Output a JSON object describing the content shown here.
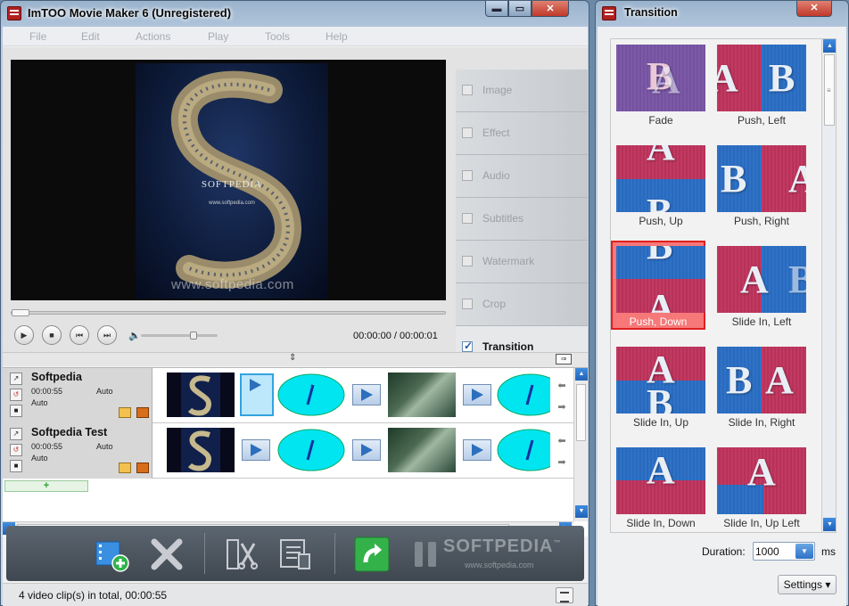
{
  "main_window": {
    "title": "ImTOO Movie Maker 6 (Unregistered)",
    "controls": {
      "minimize": "▬",
      "maximize": "▭",
      "close": "✕"
    }
  },
  "menu": [
    "File",
    "Edit",
    "Actions",
    "Play",
    "Tools",
    "Help"
  ],
  "preview": {
    "poster_brand": "SOFTPEDIA",
    "poster_url": "www.softpedia.com",
    "watermark": "www.softpedia.com",
    "seek_progress": 0.0,
    "volume_level": 0.7,
    "timecode": "00:00:00 / 00:00:01"
  },
  "side_tabs": [
    {
      "label": "Image",
      "checked": false
    },
    {
      "label": "Effect",
      "checked": false
    },
    {
      "label": "Audio",
      "checked": false
    },
    {
      "label": "Subtitles",
      "checked": false
    },
    {
      "label": "Watermark",
      "checked": false
    },
    {
      "label": "Crop",
      "checked": false
    },
    {
      "label": "Transition",
      "checked": true
    }
  ],
  "tracks": [
    {
      "name": "Softpedia",
      "duration": "00:00:55",
      "mode": "Auto",
      "audio_mode": "Auto"
    },
    {
      "name": "Softpedia Test",
      "duration": "00:00:55",
      "mode": "Auto",
      "audio_mode": "Auto"
    }
  ],
  "add_track_label": "+",
  "toolbar": {
    "watermark": "SOFTPEDIA",
    "watermark_tm": "™",
    "watermark_url": "www.softpedia.com"
  },
  "status": {
    "text": "4 video clip(s) in total, 00:00:55"
  },
  "transition_window": {
    "title": "Transition",
    "close": "✕",
    "items": [
      {
        "label": "Fade"
      },
      {
        "label": "Push, Left"
      },
      {
        "label": "Push, Up"
      },
      {
        "label": "Push, Right"
      },
      {
        "label": "Push, Down",
        "selected": true
      },
      {
        "label": "Slide In, Left"
      },
      {
        "label": "Slide In, Up"
      },
      {
        "label": "Slide In, Right"
      },
      {
        "label": "Slide In, Down"
      },
      {
        "label": "Slide In, Up Left"
      }
    ],
    "duration_label": "Duration:",
    "duration_value": "1000",
    "duration_unit": "ms",
    "settings_label": "Settings"
  },
  "colors": {
    "accent": "#2e72c8",
    "selected_transition": "#f77878",
    "close_red": "#c0392b"
  },
  "icons": [
    "app-icon",
    "play-icon",
    "stop-icon",
    "prev-icon",
    "next-icon",
    "volume-icon",
    "add-clip-icon",
    "delete-icon",
    "cut-icon",
    "edit-icon",
    "export-icon",
    "pause-icon",
    "folder-icon",
    "film-icon"
  ]
}
